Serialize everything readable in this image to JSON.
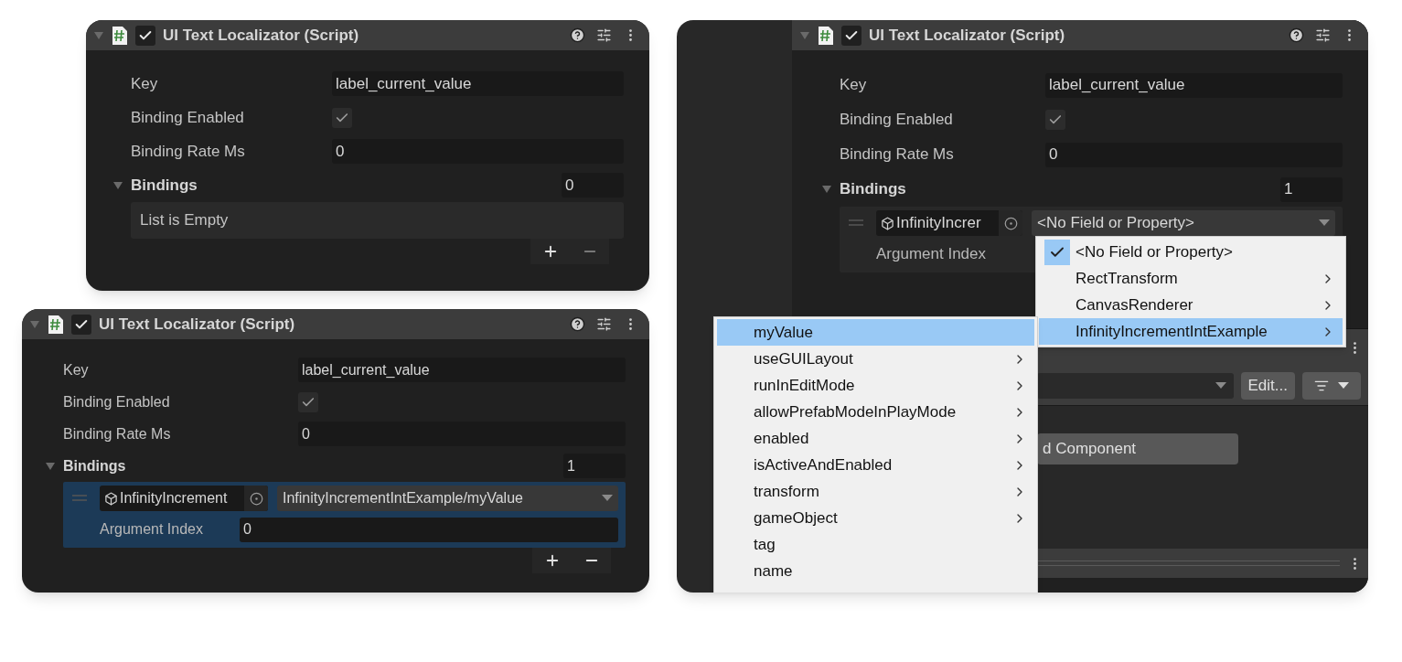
{
  "panels": [
    {
      "title": "UI Text Localizator (Script)",
      "enabled": true,
      "fields": [
        {
          "kind": "text",
          "label": "Key",
          "value": "label_current_value"
        },
        {
          "kind": "toggle",
          "label": "Binding Enabled",
          "checked": true
        },
        {
          "kind": "text",
          "label": "Binding Rate Ms",
          "value": "0"
        }
      ],
      "bindings": {
        "label": "Bindings",
        "expanded": true,
        "count": "0",
        "empty_text": "List is Empty"
      }
    },
    {
      "title": "UI Text Localizator (Script)",
      "enabled": true,
      "fields": [
        {
          "kind": "text",
          "label": "Key",
          "value": "label_current_value"
        },
        {
          "kind": "toggle",
          "label": "Binding Enabled",
          "checked": true
        },
        {
          "kind": "text",
          "label": "Binding Rate Ms",
          "value": "0"
        }
      ],
      "bindings": {
        "label": "Bindings",
        "expanded": true,
        "count": "1",
        "items": [
          {
            "object": "InfinityIncrement",
            "property": "InfinityIncrementIntExample/myValue",
            "argument_label": "Argument Index",
            "argument_value": "0",
            "selected": true
          }
        ]
      }
    },
    {
      "title": "UI Text Localizator (Script)",
      "enabled": true,
      "fields": [
        {
          "kind": "text",
          "label": "Key",
          "value": "label_current_value"
        },
        {
          "kind": "toggle",
          "label": "Binding Enabled",
          "checked": true
        },
        {
          "kind": "text",
          "label": "Binding Rate Ms",
          "value": "0"
        }
      ],
      "bindings": {
        "label": "Bindings",
        "expanded": true,
        "count": "1",
        "items": [
          {
            "object": "InfinityIncrer",
            "property": "<No Field or Property>",
            "argument_label": "Argument Index",
            "selected": false
          }
        ]
      }
    }
  ],
  "inspector_extra": {
    "edit_button": "Edit...",
    "add_component_button": "d Component"
  },
  "menus": [
    {
      "items": [
        {
          "label": "<No Field or Property>",
          "checked": true,
          "submenu": false,
          "selected": false
        },
        {
          "label": "RectTransform",
          "checked": false,
          "submenu": true,
          "selected": false
        },
        {
          "label": "CanvasRenderer",
          "checked": false,
          "submenu": true,
          "selected": false
        },
        {
          "label": "InfinityIncrementIntExample",
          "checked": false,
          "submenu": true,
          "selected": true
        }
      ]
    },
    {
      "items": [
        {
          "label": "myValue",
          "checked": false,
          "submenu": false,
          "selected": true
        },
        {
          "label": "useGUILayout",
          "checked": false,
          "submenu": true,
          "selected": false
        },
        {
          "label": "runInEditMode",
          "checked": false,
          "submenu": true,
          "selected": false
        },
        {
          "label": "allowPrefabModeInPlayMode",
          "checked": false,
          "submenu": true,
          "selected": false
        },
        {
          "label": "enabled",
          "checked": false,
          "submenu": true,
          "selected": false
        },
        {
          "label": "isActiveAndEnabled",
          "checked": false,
          "submenu": true,
          "selected": false
        },
        {
          "label": "transform",
          "checked": false,
          "submenu": true,
          "selected": false
        },
        {
          "label": "gameObject",
          "checked": false,
          "submenu": true,
          "selected": false
        },
        {
          "label": "tag",
          "checked": false,
          "submenu": false,
          "selected": false
        },
        {
          "label": "name",
          "checked": false,
          "submenu": false,
          "selected": false
        }
      ]
    }
  ]
}
